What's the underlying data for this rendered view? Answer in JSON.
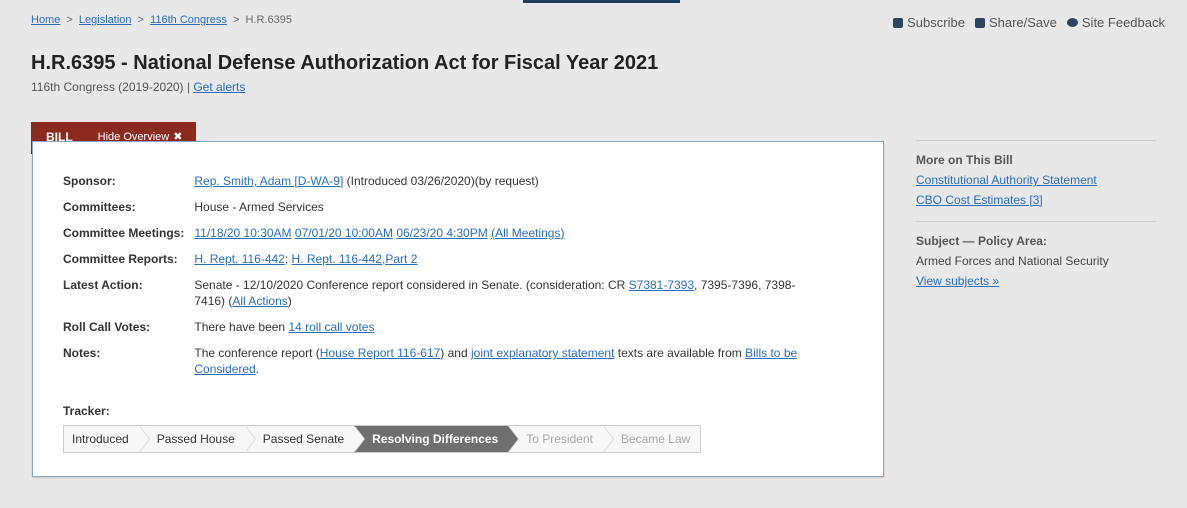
{
  "breadcrumb": {
    "home": "Home",
    "legislation": "Legislation",
    "congress": "116th Congress",
    "current": "H.R.6395",
    "sep": ">"
  },
  "utility": {
    "subscribe": "Subscribe",
    "share": "Share/Save",
    "feedback": "Site Feedback"
  },
  "title": "H.R.6395 - National Defense Authorization Act for Fiscal Year 2021",
  "subline": {
    "congress": "116th Congress (2019-2020) | ",
    "alerts": "Get alerts"
  },
  "tabs": {
    "bill": "BILL",
    "hide": "Hide Overview",
    "hide_icon": "✖"
  },
  "overview": {
    "sponsor": {
      "label": "Sponsor:",
      "link": "Rep. Smith, Adam [D-WA-9]",
      "text": " (Introduced 03/26/2020)(by request)"
    },
    "committees": {
      "label": "Committees:",
      "text": "House - Armed Services"
    },
    "meetings": {
      "label": "Committee Meetings:",
      "m1": "11/18/20 10:30AM",
      "m2": "07/01/20 10:00AM",
      "m3": "06/23/20 4:30PM",
      "all": "All Meetings"
    },
    "reports": {
      "label": "Committee Reports:",
      "r1": "H. Rept. 116-442",
      "r2": "H. Rept. 116-442,Part 2"
    },
    "latest": {
      "label": "Latest Action:",
      "text1": "Senate - 12/10/2020 Conference report considered in Senate. (consideration: CR ",
      "cr_link": "S7381-7393",
      "text2": ", 7395-7396, 7398-7416)  (",
      "all_actions": "All Actions",
      "text3": ")"
    },
    "rollcall": {
      "label": "Roll Call Votes:",
      "text": "There have been ",
      "link": "14 roll call votes"
    },
    "notes": {
      "label": "Notes:",
      "t1": "The conference report (",
      "l1": "House Report 116-617",
      "t2": ") and ",
      "l2": "joint explanatory statement",
      "t3": " texts are available from ",
      "l3": "Bills to be Considered",
      "t4": "."
    }
  },
  "tracker": {
    "label": "Tracker:",
    "steps": [
      "Introduced",
      "Passed House",
      "Passed Senate",
      "Resolving Differences",
      "To President",
      "Became Law"
    ]
  },
  "sidebar": {
    "more_heading": "More on This Bill",
    "constitutional": "Constitutional Authority Statement",
    "cbo": "CBO Cost Estimates [3]",
    "subject_heading": "Subject — Policy Area:",
    "subject": "Armed Forces and National Security",
    "view_subjects": "View subjects »"
  },
  "colors": {
    "accent": "#8b2a1e",
    "link": "#2a6ebb",
    "tracker_current": "#6f6f6f"
  }
}
